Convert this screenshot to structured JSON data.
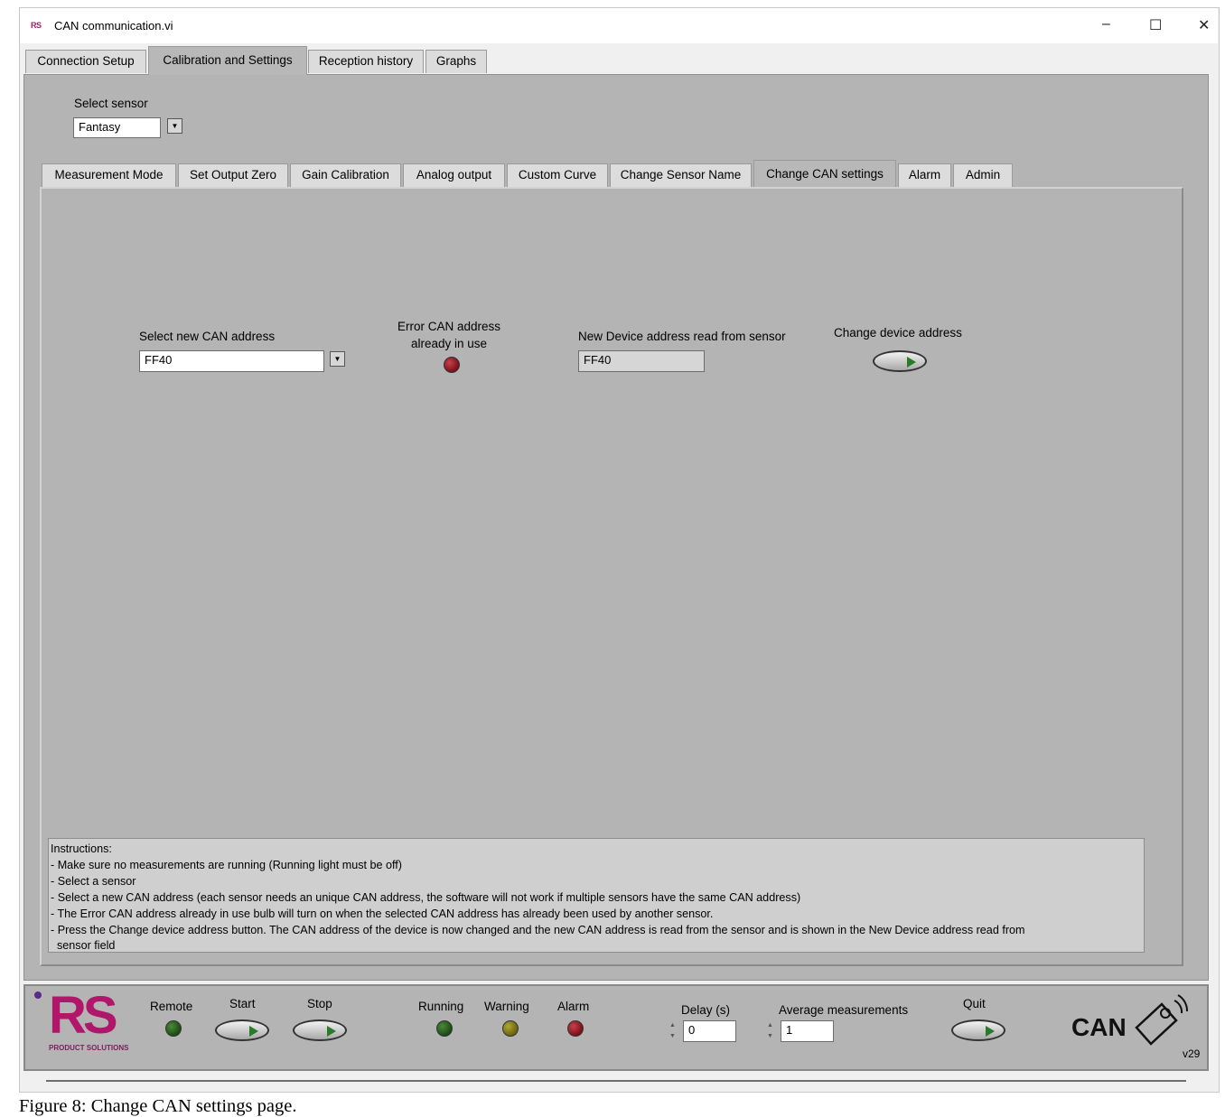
{
  "window": {
    "title": "CAN communication.vi",
    "logo_text": "RS",
    "minimize": "–",
    "maximize": "☐",
    "close": "✕"
  },
  "top_tabs": [
    "Connection Setup",
    "Calibration and Settings",
    "Reception history",
    "Graphs"
  ],
  "top_tabs_selected": "Calibration and Settings",
  "select_sensor": {
    "label": "Select sensor",
    "value": "Fantasy"
  },
  "sub_tabs": [
    "Measurement Mode",
    "Set Output Zero",
    "Gain Calibration",
    "Analog output",
    "Custom Curve",
    "Change Sensor Name",
    "Change CAN settings",
    "Alarm",
    "Admin"
  ],
  "sub_tabs_selected": "Change CAN settings",
  "can_settings": {
    "select_new_label": "Select new CAN address",
    "select_new_value": "FF40",
    "error_label_1": "Error CAN address",
    "error_label_2": "already in use",
    "readback_label": "New Device address read from sensor",
    "readback_value": "FF40",
    "change_button_label": "Change device address"
  },
  "instructions": [
    "Instructions:",
    "- Make sure no measurements are running (Running light must be off)",
    "- Select a sensor",
    "- Select a new CAN address (each sensor needs an unique CAN address, the software will not work if multiple sensors have the same CAN address)",
    "- The Error CAN address already in use bulb will turn on when the selected CAN address has already been used by another sensor.",
    "- Press the Change device address button. The CAN address of the device is now changed and the new CAN address is read from the sensor and is shown in the New Device address read from",
    "  sensor field"
  ],
  "status_bar": {
    "brand_big": "RS",
    "brand_small": "PRODUCT SOLUTIONS",
    "remote": "Remote",
    "start": "Start",
    "stop": "Stop",
    "running": "Running",
    "warning": "Warning",
    "alarm": "Alarm",
    "delay_label": "Delay (s)",
    "delay_value": "0",
    "average_label": "Average measurements",
    "average_value": "1",
    "quit": "Quit",
    "can_logo": "CAN",
    "version": "v29"
  },
  "caption": "Figure 8: Change CAN settings page."
}
